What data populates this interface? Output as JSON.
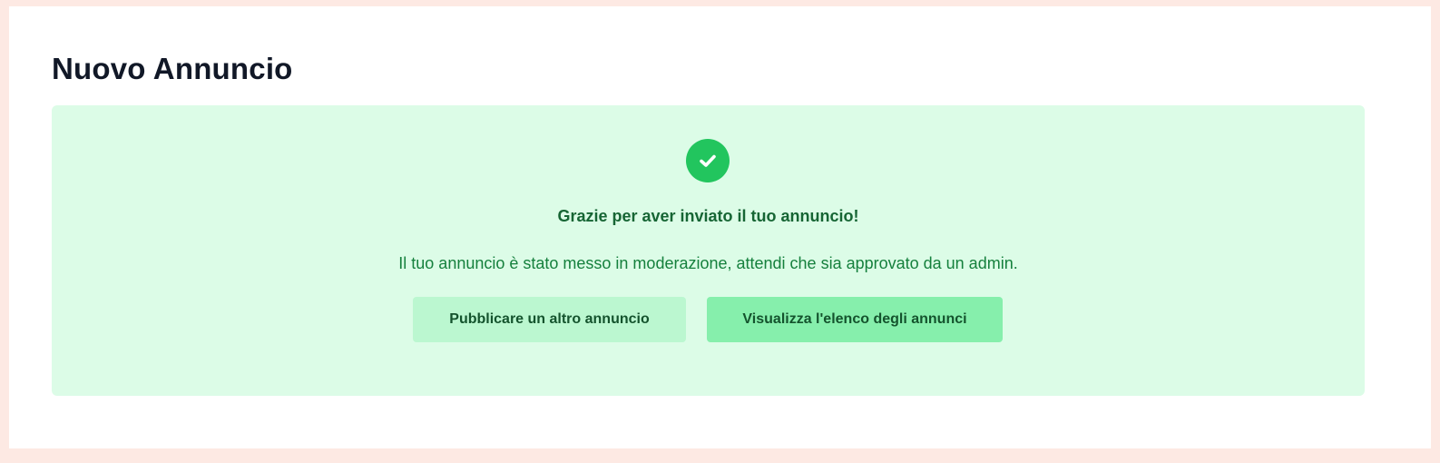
{
  "page": {
    "title": "Nuovo Annuncio"
  },
  "success": {
    "icon": "check-circle-icon",
    "heading": "Grazie per aver inviato il tuo annuncio!",
    "message": "Il tuo annuncio è stato messo in moderazione, attendi che sia approvato da un admin.",
    "buttons": {
      "publish_another": "Pubblicare un altro annuncio",
      "view_list": "Visualizza l'elenco degli annunci"
    }
  },
  "colors": {
    "page_background": "#fde9e3",
    "panel_background": "#dcfce7",
    "accent": "#22c55e",
    "heading_text": "#166534",
    "message_text": "#15803d",
    "button_light": "#bbf7d0",
    "button_strong": "#86efac"
  }
}
